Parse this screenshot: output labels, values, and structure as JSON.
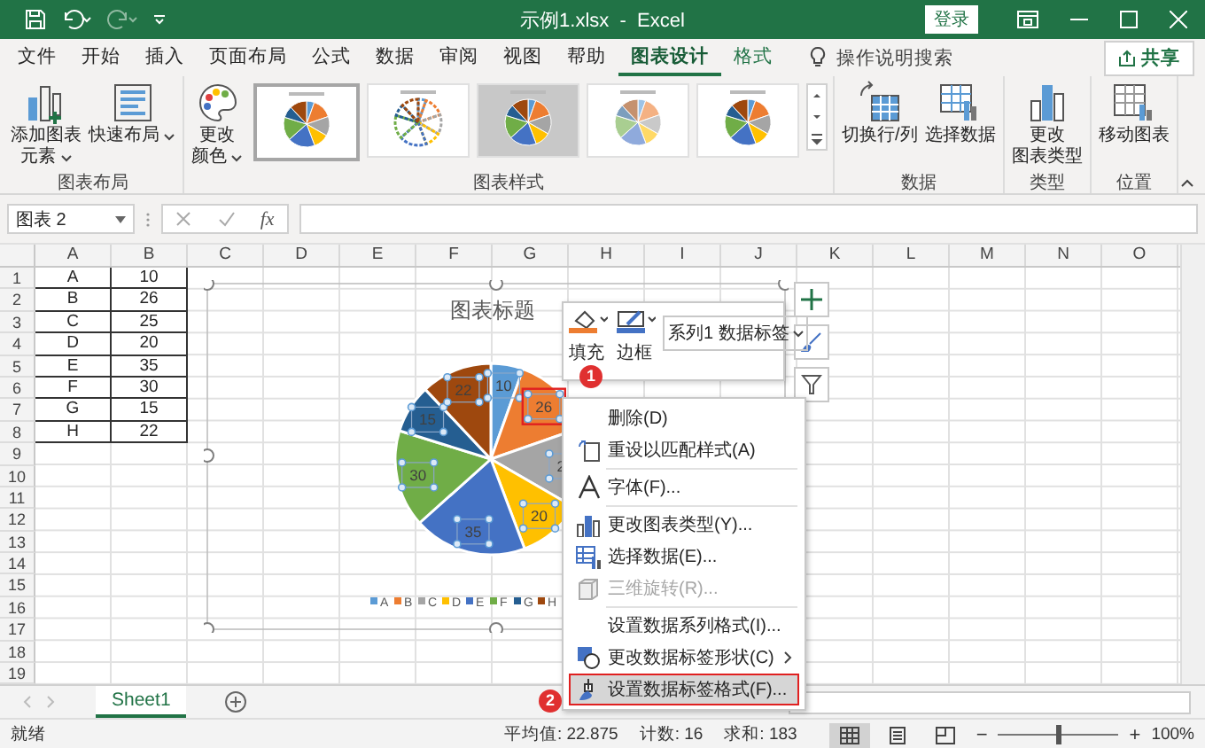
{
  "window": {
    "title": "示例1.xlsx  -  Excel",
    "sign_in": "登录"
  },
  "ribbon_tabs": [
    {
      "label": "文件",
      "selected": false,
      "kind": "tab"
    },
    {
      "label": "开始",
      "selected": false,
      "kind": "tab"
    },
    {
      "label": "插入",
      "selected": false,
      "kind": "tab"
    },
    {
      "label": "页面布局",
      "selected": false,
      "kind": "tab"
    },
    {
      "label": "公式",
      "selected": false,
      "kind": "tab"
    },
    {
      "label": "数据",
      "selected": false,
      "kind": "tab"
    },
    {
      "label": "审阅",
      "selected": false,
      "kind": "tab"
    },
    {
      "label": "视图",
      "selected": false,
      "kind": "tab"
    },
    {
      "label": "帮助",
      "selected": false,
      "kind": "tab"
    },
    {
      "label": "图表设计",
      "selected": true,
      "kind": "contextual"
    },
    {
      "label": "格式",
      "selected": false,
      "kind": "contextual"
    }
  ],
  "tell_me": "操作说明搜索",
  "share_button": "共享",
  "ribbon_groups": [
    {
      "label": "图表布局",
      "items": [
        {
          "kind": "button",
          "lines": [
            "添加图表",
            "元素"
          ],
          "dropdown": true
        },
        {
          "kind": "button",
          "lines": [
            "快速布局"
          ],
          "dropdown": true
        }
      ]
    },
    {
      "label": "图表样式",
      "items": [
        {
          "kind": "button",
          "lines": [
            "更改",
            "颜色"
          ],
          "dropdown": true
        },
        {
          "kind": "gallery",
          "styles": [
            {
              "kind": "plain",
              "selected": true
            },
            {
              "kind": "pattern",
              "selected": false
            },
            {
              "kind": "dark",
              "selected": false
            },
            {
              "kind": "light",
              "selected": false
            },
            {
              "kind": "plain",
              "selected": false
            }
          ]
        }
      ]
    },
    {
      "label": "数据",
      "items": [
        {
          "kind": "button",
          "lines": [
            "切换行/列"
          ],
          "dropdown": false
        },
        {
          "kind": "button",
          "lines": [
            "选择数据"
          ],
          "dropdown": false
        }
      ]
    },
    {
      "label": "类型",
      "items": [
        {
          "kind": "button",
          "lines": [
            "更改",
            "图表类型"
          ],
          "dropdown": false
        }
      ]
    },
    {
      "label": "位置",
      "items": [
        {
          "kind": "button",
          "lines": [
            "移动图表"
          ],
          "dropdown": false
        }
      ]
    }
  ],
  "formula_bar": {
    "name_box": "图表 2",
    "function_label": "fx"
  },
  "sheet": {
    "columns": [
      "A",
      "B",
      "C",
      "D",
      "E",
      "F",
      "G",
      "H",
      "I",
      "J",
      "K",
      "L",
      "M",
      "N",
      "O"
    ],
    "rows": [
      {
        "header": "1",
        "cells": [
          "A",
          "10"
        ]
      },
      {
        "header": "2",
        "cells": [
          "B",
          "26"
        ]
      },
      {
        "header": "3",
        "cells": [
          "C",
          "25"
        ]
      },
      {
        "header": "4",
        "cells": [
          "D",
          "20"
        ]
      },
      {
        "header": "5",
        "cells": [
          "E",
          "35"
        ]
      },
      {
        "header": "6",
        "cells": [
          "F",
          "30"
        ]
      },
      {
        "header": "7",
        "cells": [
          "G",
          "15"
        ]
      },
      {
        "header": "8",
        "cells": [
          "H",
          "22"
        ]
      },
      {
        "header": "9"
      },
      {
        "header": "10"
      },
      {
        "header": "11"
      },
      {
        "header": "12"
      },
      {
        "header": "13"
      },
      {
        "header": "14"
      },
      {
        "header": "15"
      },
      {
        "header": "16"
      },
      {
        "header": "17"
      },
      {
        "header": "18"
      },
      {
        "header": "19"
      }
    ]
  },
  "chart": {
    "selected": true,
    "labels_selected": true,
    "label_marks": [
      {
        "outlined": false
      },
      {
        "outlined": true
      },
      {
        "outlined": false
      },
      {
        "outlined": false
      },
      {
        "outlined": false
      },
      {
        "outlined": false
      },
      {
        "outlined": false
      },
      {
        "outlined": false
      }
    ],
    "chart_data": {
      "type": "pie",
      "title": "图表标题",
      "categories": [
        "A",
        "B",
        "C",
        "D",
        "E",
        "F",
        "G",
        "H"
      ],
      "values": [
        10,
        26,
        25,
        20,
        35,
        30,
        15,
        22
      ],
      "data_labels": true,
      "legend": "bottom"
    }
  },
  "mini_toolbar": {
    "fill": "填充",
    "border": "边框",
    "element_select": "系列1 数据标签"
  },
  "context_menu": [
    [
      {
        "label": "删除(D)",
        "kind": "item",
        "disabled": false,
        "selected": false,
        "outlined": false
      },
      {
        "label": "重设以匹配样式(A)",
        "kind": "item",
        "disabled": false,
        "selected": false,
        "outlined": false
      }
    ],
    [
      {
        "label": "字体(F)...",
        "kind": "item",
        "disabled": false,
        "selected": false,
        "outlined": false
      }
    ],
    [
      {
        "label": "更改图表类型(Y)...",
        "kind": "item",
        "disabled": false,
        "selected": false,
        "outlined": false
      },
      {
        "label": "选择数据(E)...",
        "kind": "item",
        "disabled": false,
        "selected": false,
        "outlined": false
      },
      {
        "label": "三维旋转(R)...",
        "kind": "item",
        "disabled": true,
        "selected": false,
        "outlined": false
      }
    ],
    [
      {
        "label": "设置数据系列格式(I)...",
        "kind": "item",
        "disabled": false,
        "selected": false,
        "outlined": false
      },
      {
        "label": "更改数据标签形状(C)",
        "kind": "submenu",
        "disabled": false,
        "selected": false,
        "outlined": false
      },
      {
        "label": "设置数据标签格式(F)...",
        "kind": "item",
        "disabled": false,
        "selected": true,
        "outlined": true
      }
    ]
  ],
  "callouts": [
    "1",
    "2"
  ],
  "sheet_tabs": [
    {
      "label": "Sheet1",
      "selected": true
    }
  ],
  "status_bar": {
    "mode": "就绪",
    "average": "平均值: 22.875",
    "count": "计数: 16",
    "sum": "求和: 183",
    "views": [
      {
        "kind": "normal",
        "selected": true
      },
      {
        "kind": "page-layout",
        "selected": false
      },
      {
        "kind": "page-break",
        "selected": false
      }
    ],
    "zoom_out": "−",
    "zoom_in": "+",
    "zoom": {
      "level": 0.5,
      "label": "100%"
    }
  }
}
